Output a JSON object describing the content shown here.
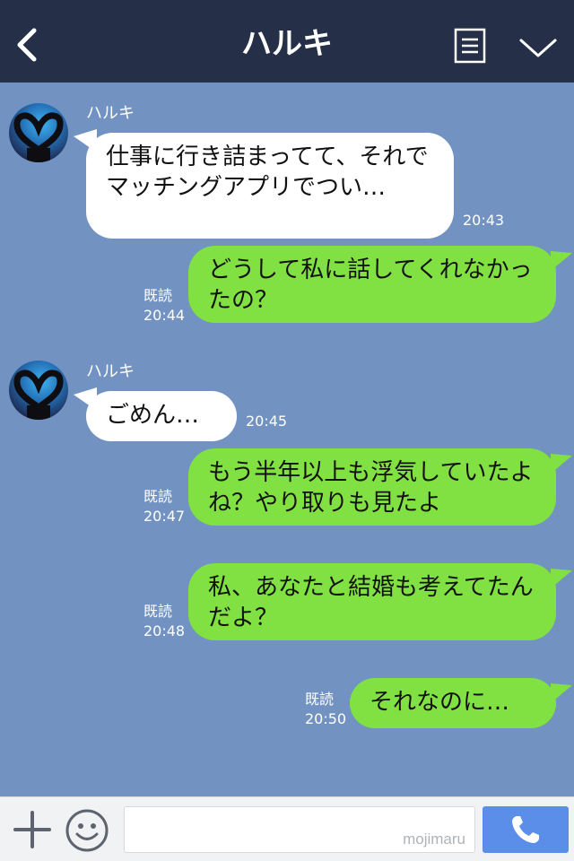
{
  "header": {
    "title": "ハルキ",
    "back_icon": "chevron-left-icon",
    "menu_icon": "list-menu-icon",
    "expand_icon": "chevron-down-icon"
  },
  "messages": [
    {
      "direction": "in",
      "sender": "ハルキ",
      "text": "仕事に行き詰まってて、それでマッチングアプリでつい…",
      "time": "20:43"
    },
    {
      "direction": "out",
      "text": "どうして私に話してくれなかったの？",
      "read": "既読",
      "time": "20:44"
    },
    {
      "direction": "in",
      "sender": "ハルキ",
      "text": "ごめん…",
      "time": "20:45"
    },
    {
      "direction": "out",
      "text": "もう半年以上も浮気していたよね？やり取りも見たよ",
      "read": "既読",
      "time": "20:47"
    },
    {
      "direction": "out",
      "text": "私、あなたと結婚も考えてたんだよ？",
      "read": "既読",
      "time": "20:48"
    },
    {
      "direction": "out",
      "text": "それなのに…",
      "read": "既読",
      "time": "20:50"
    }
  ],
  "input": {
    "placeholder": "",
    "watermark": "mojimaru"
  },
  "colors": {
    "header": "#253048",
    "background": "#7293c2",
    "outgoing": "#82e142",
    "incoming": "#ffffff",
    "call_button": "#5a8ee8"
  }
}
